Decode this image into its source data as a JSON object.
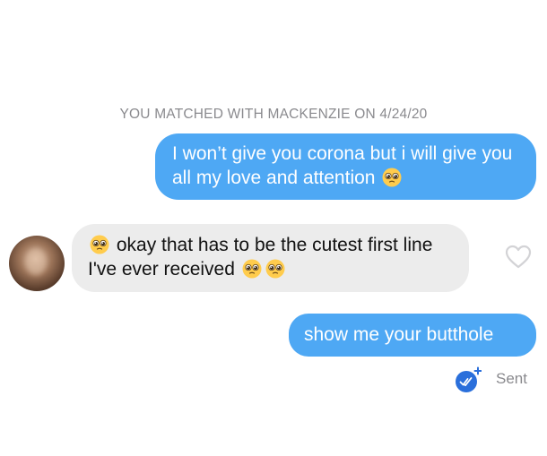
{
  "match_banner": "YOU MATCHED WITH MACKENZIE ON 4/24/20",
  "messages": [
    {
      "sender": "me",
      "text": "I won’t give you corona but i will give you all my love and attention",
      "emojis": [
        "pleading-face"
      ]
    },
    {
      "sender": "them",
      "lead_emoji": "pleading-face",
      "text": "okay that has to be the cutest first line I've ever received",
      "emojis": [
        "pleading-face",
        "pleading-face"
      ]
    },
    {
      "sender": "me",
      "text": "show me your butthole"
    }
  ],
  "status": {
    "label": "Sent",
    "icon": "double-check-icon"
  },
  "colors": {
    "outgoing_bubble": "#4ea8f4",
    "incoming_bubble": "#ececec",
    "meta_text": "#8a8a8e",
    "receipt_blue": "#2a6fdb"
  }
}
